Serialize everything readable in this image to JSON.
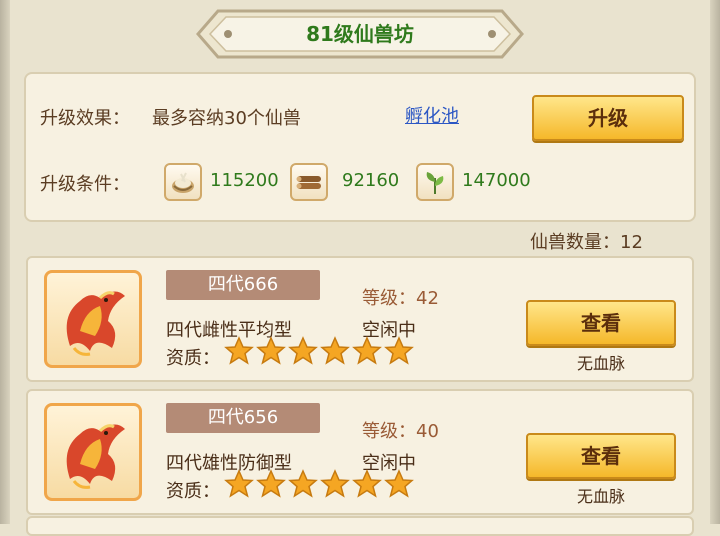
{
  "window": {
    "title": "81级仙兽坊"
  },
  "upgrade": {
    "effect_label": "升级效果：",
    "effect_text": "最多容纳30个仙兽",
    "link_label": "孵化池",
    "button_label": "升级",
    "condition_label": "升级条件：",
    "resources": [
      {
        "icon": "nest-icon",
        "value": "115200"
      },
      {
        "icon": "wood-logs-icon",
        "value": "92160"
      },
      {
        "icon": "herb-leaf-icon",
        "value": "147000"
      }
    ]
  },
  "beast_count": {
    "label": "仙兽数量：",
    "value": "12"
  },
  "beasts": [
    {
      "name": "四代666",
      "type": "四代雌性平均型",
      "level_label": "等级：",
      "level": "42",
      "status": "空闲中",
      "quality_label": "资质：",
      "stars": 6,
      "button_label": "查看",
      "bloodline": "无血脉",
      "portrait_icon": "phoenix-icon"
    },
    {
      "name": "四代656",
      "type": "四代雄性防御型",
      "level_label": "等级：",
      "level": "40",
      "status": "空闲中",
      "quality_label": "资质：",
      "stars": 6,
      "button_label": "查看",
      "bloodline": "无血脉",
      "portrait_icon": "phoenix-icon"
    }
  ],
  "colors": {
    "title_green": "#2f7a1c",
    "value_green": "#2f7a1c",
    "link_blue": "#2c57c4",
    "button_gold": "#f5b82a",
    "badge_brown": "#b48b76",
    "star_gold": "#f5a623"
  }
}
